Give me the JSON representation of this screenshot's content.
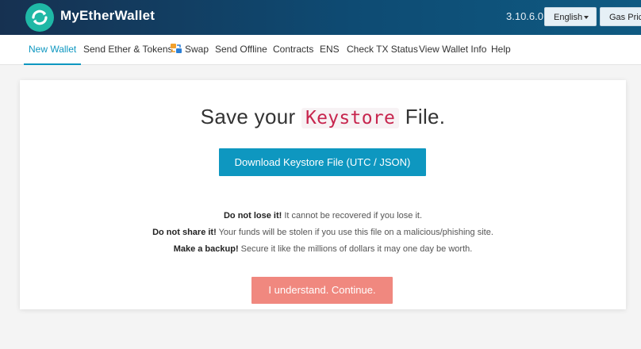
{
  "header": {
    "brand": "MyEtherWallet",
    "version": "3.10.6.0",
    "language_label": "English",
    "gas_label": "Gas Price"
  },
  "nav": {
    "items": [
      {
        "label": "New Wallet",
        "active": true
      },
      {
        "label": "Send Ether & Tokens"
      },
      {
        "label": "Swap"
      },
      {
        "label": "Send Offline"
      },
      {
        "label": "Contracts"
      },
      {
        "label": "ENS"
      },
      {
        "label": "Check TX Status"
      },
      {
        "label": "View Wallet Info"
      },
      {
        "label": "Help"
      }
    ]
  },
  "main": {
    "title_prefix": "Save your",
    "title_code": "Keystore",
    "title_suffix": "File.",
    "download_label": "Download Keystore File (UTC / JSON)",
    "warnings": [
      {
        "bold": "Do not lose it!",
        "text": " It cannot be recovered if you lose it."
      },
      {
        "bold": "Do not share it!",
        "text": " Your funds will be stolen if you use this file on a malicious/phishing site."
      },
      {
        "bold": "Make a backup!",
        "text": " Secure it like the millions of dollars it may one day be worth."
      }
    ],
    "continue_label": "I understand. Continue."
  },
  "colors": {
    "accent": "#0e97c0",
    "continue": "#f0887f",
    "logo": "#1fb8a6",
    "code": "#c7254e"
  }
}
